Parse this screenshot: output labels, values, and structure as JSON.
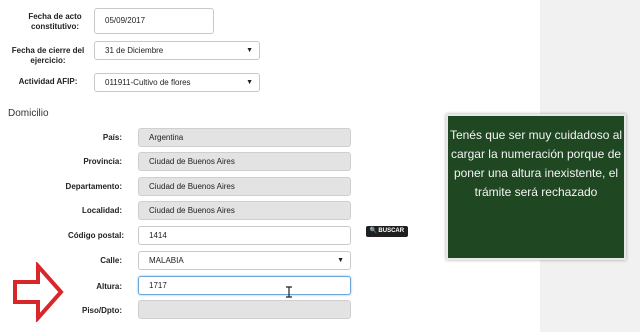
{
  "form": {
    "fecha_acto": {
      "label": "Fecha de acto constitutivo:",
      "value": "05/09/2017"
    },
    "fecha_cierre": {
      "label": "Fecha de cierre del ejercicio:",
      "value": "31 de Diciembre"
    },
    "actividad": {
      "label": "Actividad AFIP:",
      "value": "011911-Cultivo de flores"
    }
  },
  "domicilio": {
    "title": "Domicilio",
    "pais": {
      "label": "País:",
      "value": "Argentina"
    },
    "provincia": {
      "label": "Provincia:",
      "value": "Ciudad de Buenos Aires"
    },
    "departamento": {
      "label": "Departamento:",
      "value": "Ciudad de Buenos Aires"
    },
    "localidad": {
      "label": "Localidad:",
      "value": "Ciudad de Buenos Aires"
    },
    "codigo_postal": {
      "label": "Código postal:",
      "value": "1414"
    },
    "buscar_label": "BUSCAR",
    "calle": {
      "label": "Calle:",
      "value": "MALABIA"
    },
    "altura": {
      "label": "Altura:",
      "value": "1717"
    },
    "piso": {
      "label": "Piso/Dpto:",
      "value": ""
    }
  },
  "callout": {
    "text": "Tenés que ser muy cuidadoso al cargar la numeración porque de poner una altura inexistente, el trámite será rechazado"
  },
  "colors": {
    "callout_bg": "#1f4721",
    "arrow": "#d8272b",
    "focus": "#6ea6d8"
  },
  "icons": {
    "arrow": "right-arrow-icon",
    "search": "search-icon",
    "cursor": "text-cursor-icon"
  }
}
